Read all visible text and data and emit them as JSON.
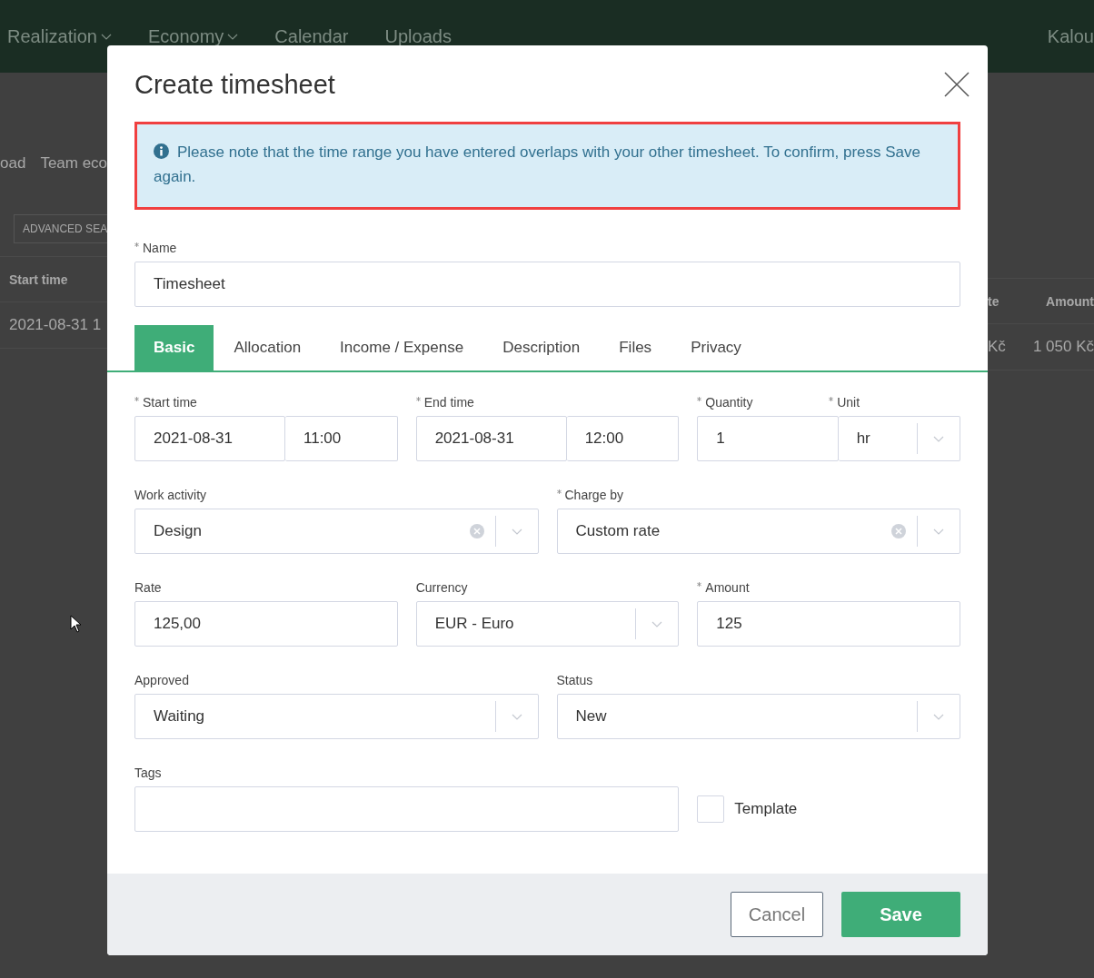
{
  "nav": {
    "items": [
      {
        "label": "Realization",
        "dropdown": true
      },
      {
        "label": "Economy",
        "dropdown": true
      },
      {
        "label": "Calendar",
        "dropdown": false
      },
      {
        "label": "Uploads",
        "dropdown": false
      }
    ],
    "user": "Kalou"
  },
  "background": {
    "tabs": [
      "oad",
      "Team eco"
    ],
    "advanced_search": "ADVANCED SEA",
    "table": {
      "columns": [
        "Start time",
        "te",
        "Amount"
      ],
      "rows": [
        [
          "2021-08-31 1",
          "Kč",
          "1 050 Kč"
        ]
      ]
    }
  },
  "dialog": {
    "title": "Create timesheet",
    "alert": {
      "text": "Please note that the time range you have entered overlaps with your other timesheet. To confirm, press Save again.",
      "highlighted": true
    },
    "name": {
      "label": "Name",
      "required": true,
      "value": "Timesheet"
    },
    "tabs": [
      {
        "label": "Basic",
        "selected": true
      },
      {
        "label": "Allocation",
        "selected": false
      },
      {
        "label": "Income / Expense",
        "selected": false
      },
      {
        "label": "Description",
        "selected": false
      },
      {
        "label": "Files",
        "selected": false
      },
      {
        "label": "Privacy",
        "selected": false
      }
    ],
    "rows": [
      [
        {
          "kind": "datetime",
          "label": "Start time",
          "required": true,
          "date": "2021-08-31",
          "time": "11:00"
        },
        {
          "kind": "datetime",
          "label": "End time",
          "required": true,
          "date": "2021-08-31",
          "time": "12:00"
        },
        {
          "kind": "quantity",
          "label": "Quantity",
          "required": true,
          "value": "1",
          "unit_label": "Unit",
          "unit_required": true,
          "unit": "hr"
        }
      ],
      [
        {
          "kind": "select",
          "label": "Work activity",
          "required": false,
          "value": "Design",
          "clearable": true
        },
        {
          "kind": "select",
          "label": "Charge by",
          "required": true,
          "value": "Custom rate",
          "clearable": true
        }
      ],
      [
        {
          "kind": "text",
          "label": "Rate",
          "required": false,
          "value": "125,00"
        },
        {
          "kind": "select",
          "label": "Currency",
          "required": false,
          "value": "EUR - Euro",
          "clearable": false
        },
        {
          "kind": "text",
          "label": "Amount",
          "required": true,
          "value": "125"
        }
      ],
      [
        {
          "kind": "select",
          "label": "Approved",
          "required": false,
          "value": "Waiting",
          "clearable": false
        },
        {
          "kind": "select",
          "label": "Status",
          "required": false,
          "value": "New",
          "clearable": false
        }
      ],
      [
        {
          "kind": "tags",
          "label": "Tags",
          "required": false
        },
        {
          "kind": "checkbox",
          "label": "Template",
          "checked": false
        }
      ]
    ],
    "buttons": [
      {
        "label": "Cancel",
        "kind": "secondary"
      },
      {
        "label": "Save",
        "kind": "primary"
      }
    ]
  }
}
